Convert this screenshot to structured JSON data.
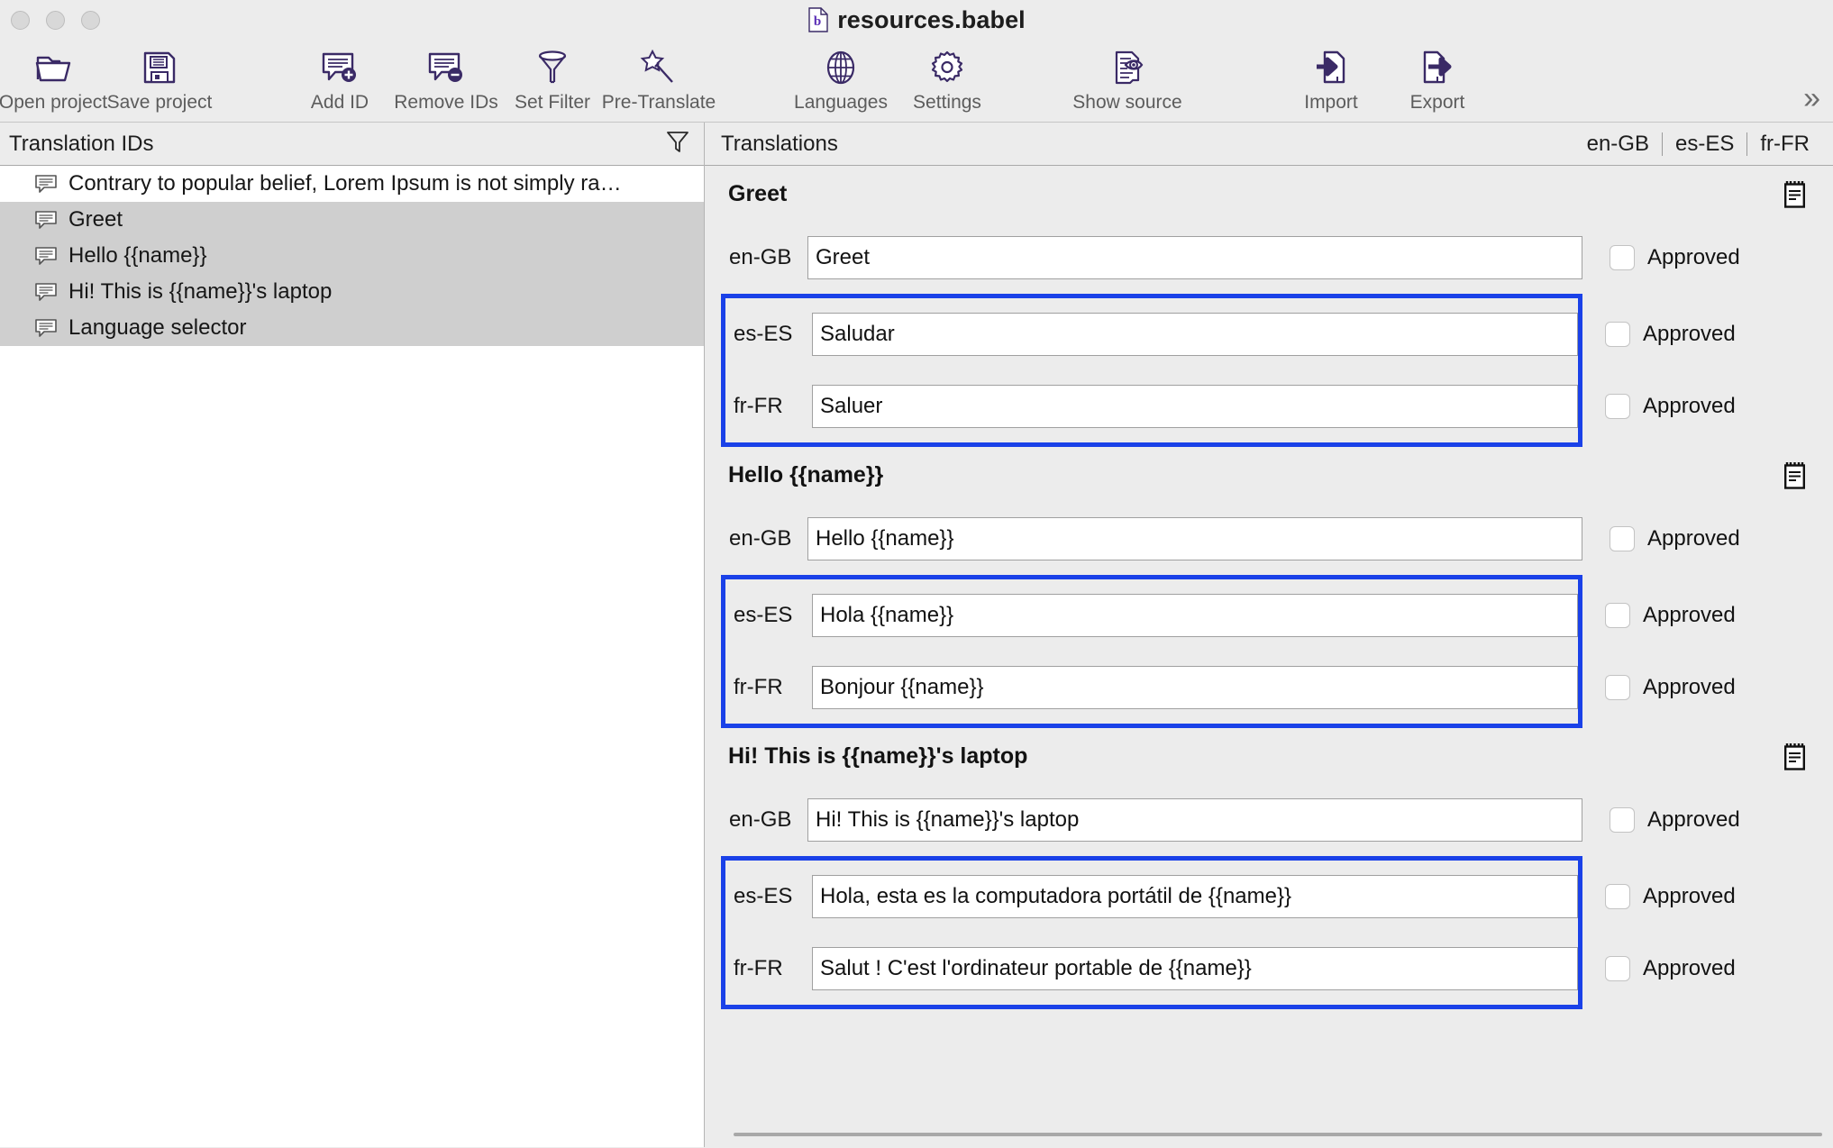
{
  "window": {
    "title": "resources.babel",
    "doc_icon": "babel-document-icon",
    "traffic_lights": [
      "close",
      "minimize",
      "maximize"
    ]
  },
  "toolbar": {
    "items": [
      {
        "label": "Open project",
        "icon": "open-folder-icon"
      },
      {
        "label": "Save project",
        "icon": "floppy-disk-icon"
      },
      {
        "label": "Add ID",
        "icon": "speech-bubble-plus-icon"
      },
      {
        "label": "Remove IDs",
        "icon": "speech-bubble-minus-icon"
      },
      {
        "label": "Set Filter",
        "icon": "funnel-icon"
      },
      {
        "label": "Pre-Translate",
        "icon": "magic-wand-icon"
      },
      {
        "label": "Languages",
        "icon": "globe-icon"
      },
      {
        "label": "Settings",
        "icon": "gear-icon"
      },
      {
        "label": "Show source",
        "icon": "document-eye-icon"
      },
      {
        "label": "Import",
        "icon": "import-arrow-icon"
      },
      {
        "label": "Export",
        "icon": "export-arrow-icon"
      }
    ],
    "overflow": "»"
  },
  "left_panel": {
    "header": "Translation IDs",
    "filter_icon": "funnel-icon",
    "items": [
      {
        "label": "Contrary to popular belief, Lorem Ipsum is not simply ra…",
        "selected": false
      },
      {
        "label": "Greet",
        "selected": true
      },
      {
        "label": "Hello {{name}}",
        "selected": true
      },
      {
        "label": "Hi! This is {{name}}'s laptop",
        "selected": true
      },
      {
        "label": "Language selector",
        "selected": true
      }
    ]
  },
  "right_panel": {
    "header": "Translations",
    "language_tabs": [
      "en-GB",
      "es-ES",
      "fr-FR"
    ],
    "approved_label": "Approved",
    "notepad_icon": "notepad-icon",
    "highlight_color": "#1a41e8",
    "groups": [
      {
        "title": "Greet",
        "rows": [
          {
            "lang": "en-GB",
            "value": "Greet",
            "approved": false,
            "highlighted": false
          },
          {
            "lang": "es-ES",
            "value": "Saludar",
            "approved": false,
            "highlighted": true
          },
          {
            "lang": "fr-FR",
            "value": "Saluer",
            "approved": false,
            "highlighted": true
          }
        ]
      },
      {
        "title": "Hello {{name}}",
        "rows": [
          {
            "lang": "en-GB",
            "value": "Hello {{name}}",
            "approved": false,
            "highlighted": false
          },
          {
            "lang": "es-ES",
            "value": "Hola {{name}}",
            "approved": false,
            "highlighted": true
          },
          {
            "lang": "fr-FR",
            "value": "Bonjour {{name}}",
            "approved": false,
            "highlighted": true
          }
        ]
      },
      {
        "title": "Hi! This is {{name}}'s laptop",
        "rows": [
          {
            "lang": "en-GB",
            "value": "Hi! This is {{name}}'s laptop",
            "approved": false,
            "highlighted": false
          },
          {
            "lang": "es-ES",
            "value": "Hola, esta es la computadora portátil de {{name}}",
            "approved": false,
            "highlighted": true
          },
          {
            "lang": "fr-FR",
            "value": "Salut ! C'est l'ordinateur portable de {{name}}",
            "approved": false,
            "highlighted": true
          }
        ]
      }
    ]
  }
}
